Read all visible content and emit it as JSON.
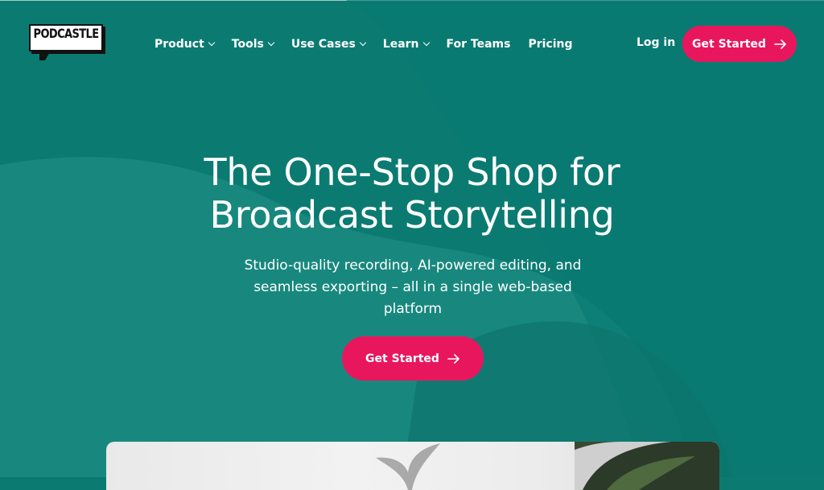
{
  "logo": {
    "text": "PODCASTLE"
  },
  "nav": {
    "items": [
      {
        "label": "Product",
        "has_dropdown": true
      },
      {
        "label": "Tools",
        "has_dropdown": true
      },
      {
        "label": "Use Cases",
        "has_dropdown": true
      },
      {
        "label": "Learn",
        "has_dropdown": true
      },
      {
        "label": "For Teams",
        "has_dropdown": false
      },
      {
        "label": "Pricing",
        "has_dropdown": false
      }
    ],
    "login_label": "Log in",
    "cta_label": "Get Started"
  },
  "hero": {
    "title_line1": "The One-Stop Shop for",
    "title_line2": "Broadcast Storytelling",
    "subtitle": "Studio-quality recording, AI-powered editing, and seamless exporting – all in a single web-based platform",
    "cta_label": "Get Started"
  },
  "colors": {
    "background": "#0b7b72",
    "accent": "#e8175d",
    "text": "#ffffff"
  },
  "icons": {
    "cta_arrow": "arrow-right-icon",
    "dropdown": "chevron-down-icon"
  }
}
